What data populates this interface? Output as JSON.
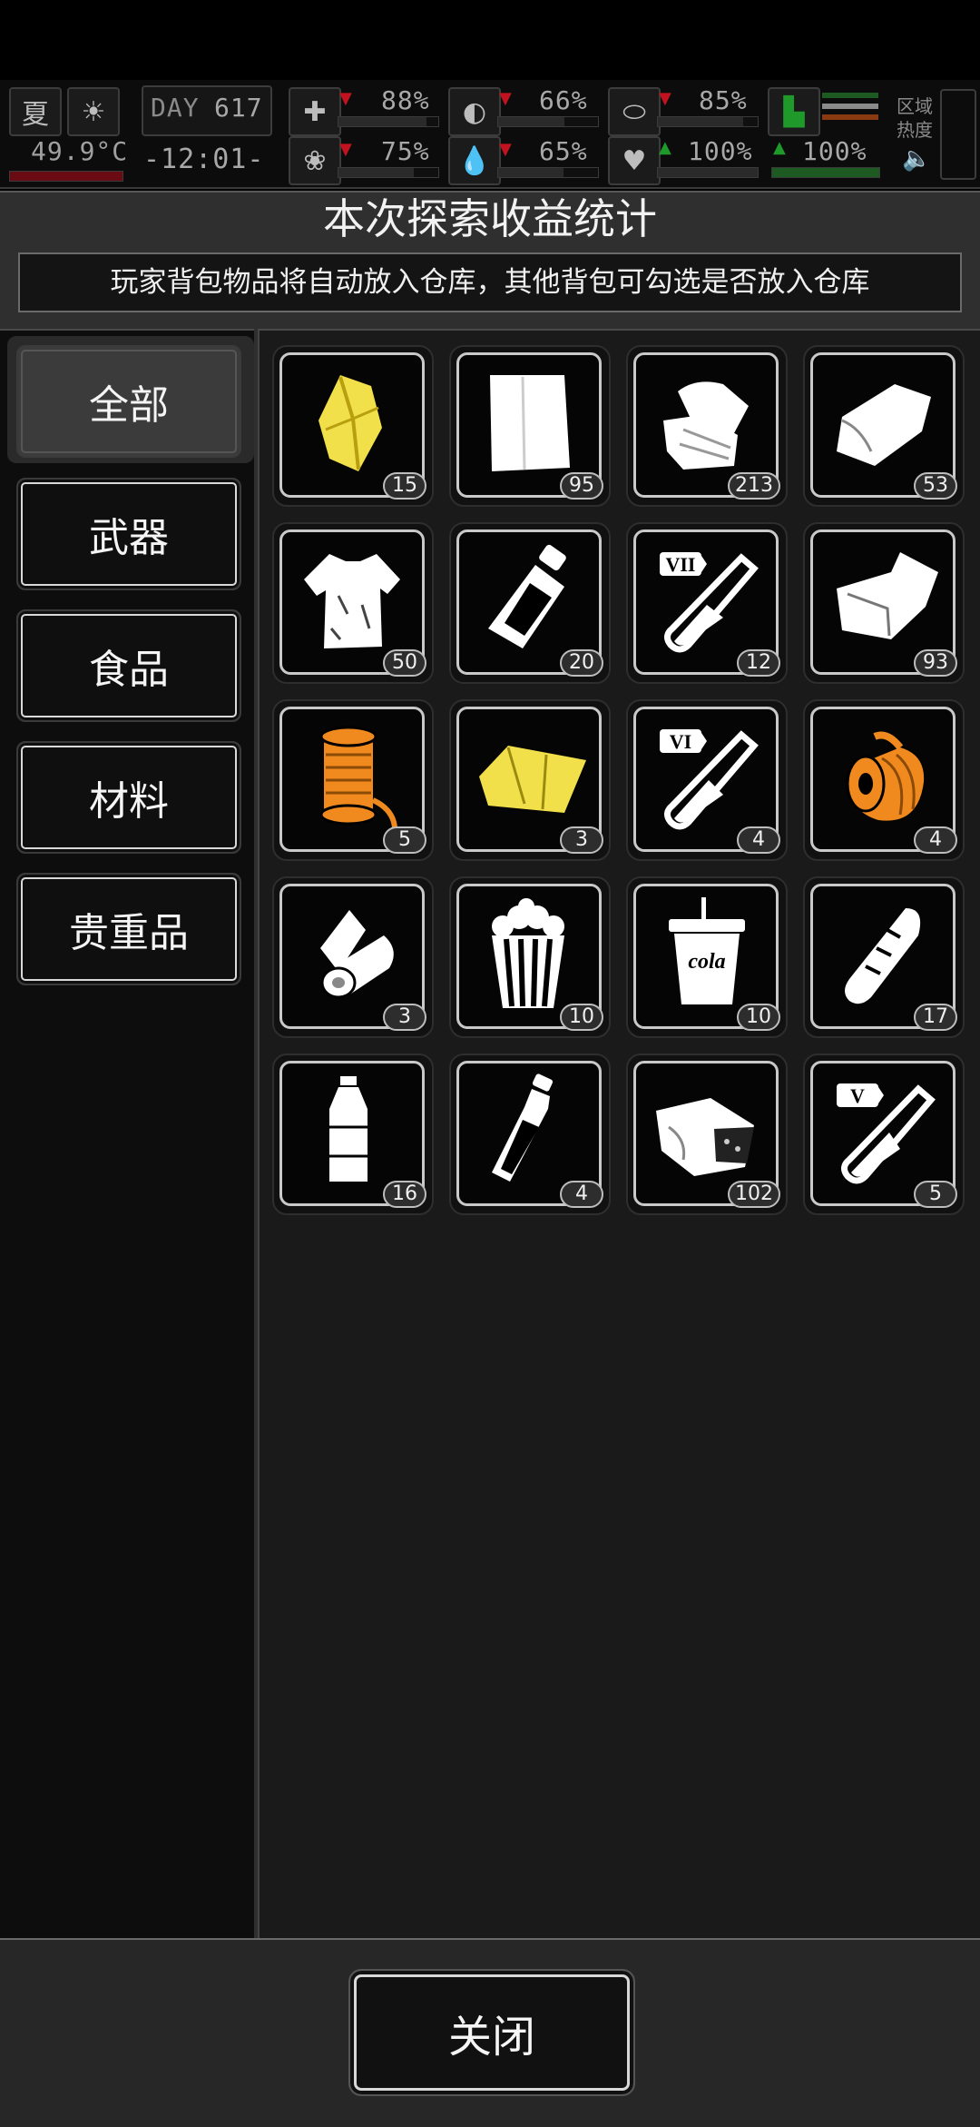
{
  "status": {
    "season": "夏",
    "temperature": "49.9°C",
    "day_label": "DAY",
    "day_value": "617",
    "time": "-12:01-",
    "stats": [
      {
        "name": "health",
        "value": "88%",
        "trend": "down"
      },
      {
        "name": "hunger",
        "value": "66%",
        "trend": "down"
      },
      {
        "name": "energy",
        "value": "85%",
        "trend": "down"
      },
      {
        "name": "sanity",
        "value": "75%",
        "trend": "down"
      },
      {
        "name": "thirst",
        "value": "65%",
        "trend": "down"
      },
      {
        "name": "mood",
        "value": "100%",
        "trend": "up"
      },
      {
        "name": "stamina",
        "value": "100%",
        "trend": "up"
      }
    ],
    "region_label": "区域热度"
  },
  "panel": {
    "title": "本次探索收益统计",
    "notice": "玩家背包物品将自动放入仓库，其他背包可勾选是否放入仓库"
  },
  "categories": [
    {
      "label": "全部",
      "active": true
    },
    {
      "label": "武器",
      "active": false
    },
    {
      "label": "食品",
      "active": false
    },
    {
      "label": "材料",
      "active": false
    },
    {
      "label": "贵重品",
      "active": false
    }
  ],
  "items": [
    {
      "icon": "leaf-icon",
      "count": "15",
      "color": "#f2e04a"
    },
    {
      "icon": "paper-icon",
      "count": "95",
      "color": "#ffffff"
    },
    {
      "icon": "folded-cloth-icon",
      "count": "213",
      "color": "#ffffff"
    },
    {
      "icon": "cloth-icon",
      "count": "53",
      "color": "#ffffff"
    },
    {
      "icon": "torn-shirt-icon",
      "count": "50",
      "color": "#ffffff"
    },
    {
      "icon": "energy-gel-icon",
      "count": "20",
      "color": "#ffffff"
    },
    {
      "icon": "test-tube-icon",
      "count": "12",
      "badge": "VII",
      "color": "#ffffff"
    },
    {
      "icon": "rag-icon",
      "count": "93",
      "color": "#ffffff"
    },
    {
      "icon": "rope-spool-icon",
      "count": "5",
      "color": "#f08a1e"
    },
    {
      "icon": "tarp-icon",
      "count": "3",
      "color": "#f2e04a"
    },
    {
      "icon": "test-tube-icon",
      "count": "4",
      "badge": "VI",
      "color": "#ffffff"
    },
    {
      "icon": "hose-icon",
      "count": "4",
      "color": "#f08a1e"
    },
    {
      "icon": "bandage-roll-icon",
      "count": "3",
      "color": "#ffffff"
    },
    {
      "icon": "popcorn-icon",
      "count": "10",
      "color": "#ffffff"
    },
    {
      "icon": "cola-cup-icon",
      "count": "10",
      "label": "cola",
      "color": "#ffffff"
    },
    {
      "icon": "bread-icon",
      "count": "17",
      "color": "#ffffff"
    },
    {
      "icon": "water-bottle-icon",
      "count": "16",
      "color": "#ffffff"
    },
    {
      "icon": "milk-bottle-icon",
      "count": "4",
      "color": "#ffffff"
    },
    {
      "icon": "ration-pack-icon",
      "count": "102",
      "color": "#ffffff"
    },
    {
      "icon": "test-tube-icon",
      "count": "5",
      "badge": "V",
      "color": "#ffffff"
    }
  ],
  "close_label": "关闭"
}
